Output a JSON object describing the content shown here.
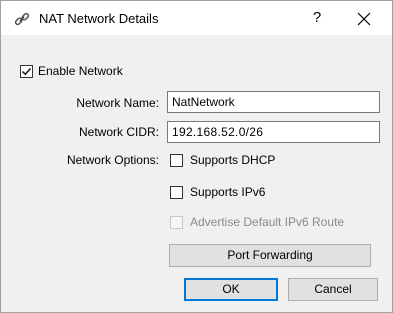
{
  "window": {
    "title": "NAT Network Details",
    "help_glyph": "?",
    "close_glyph": "✕"
  },
  "enable_network": {
    "label": "Enable Network",
    "checked": true
  },
  "network_name": {
    "label": "Network Name:",
    "value": "NatNetwork"
  },
  "network_cidr": {
    "label": "Network CIDR:",
    "value": "192.168.52.0/26"
  },
  "network_options": {
    "label": "Network Options:",
    "supports_dhcp": {
      "label": "Supports DHCP",
      "checked": false
    },
    "supports_ipv6": {
      "label": "Supports IPv6",
      "checked": false
    },
    "advertise_ipv6_route": {
      "label": "Advertise Default IPv6 Route",
      "checked": false,
      "enabled": false
    }
  },
  "buttons": {
    "port_forwarding": "Port Forwarding",
    "ok": "OK",
    "cancel": "Cancel"
  },
  "icons": {
    "title_icon": "network-link-icon",
    "check_icon": "check-icon"
  },
  "colors": {
    "dialog_bg": "#f0f0f0",
    "default_button_border": "#0078d7"
  }
}
